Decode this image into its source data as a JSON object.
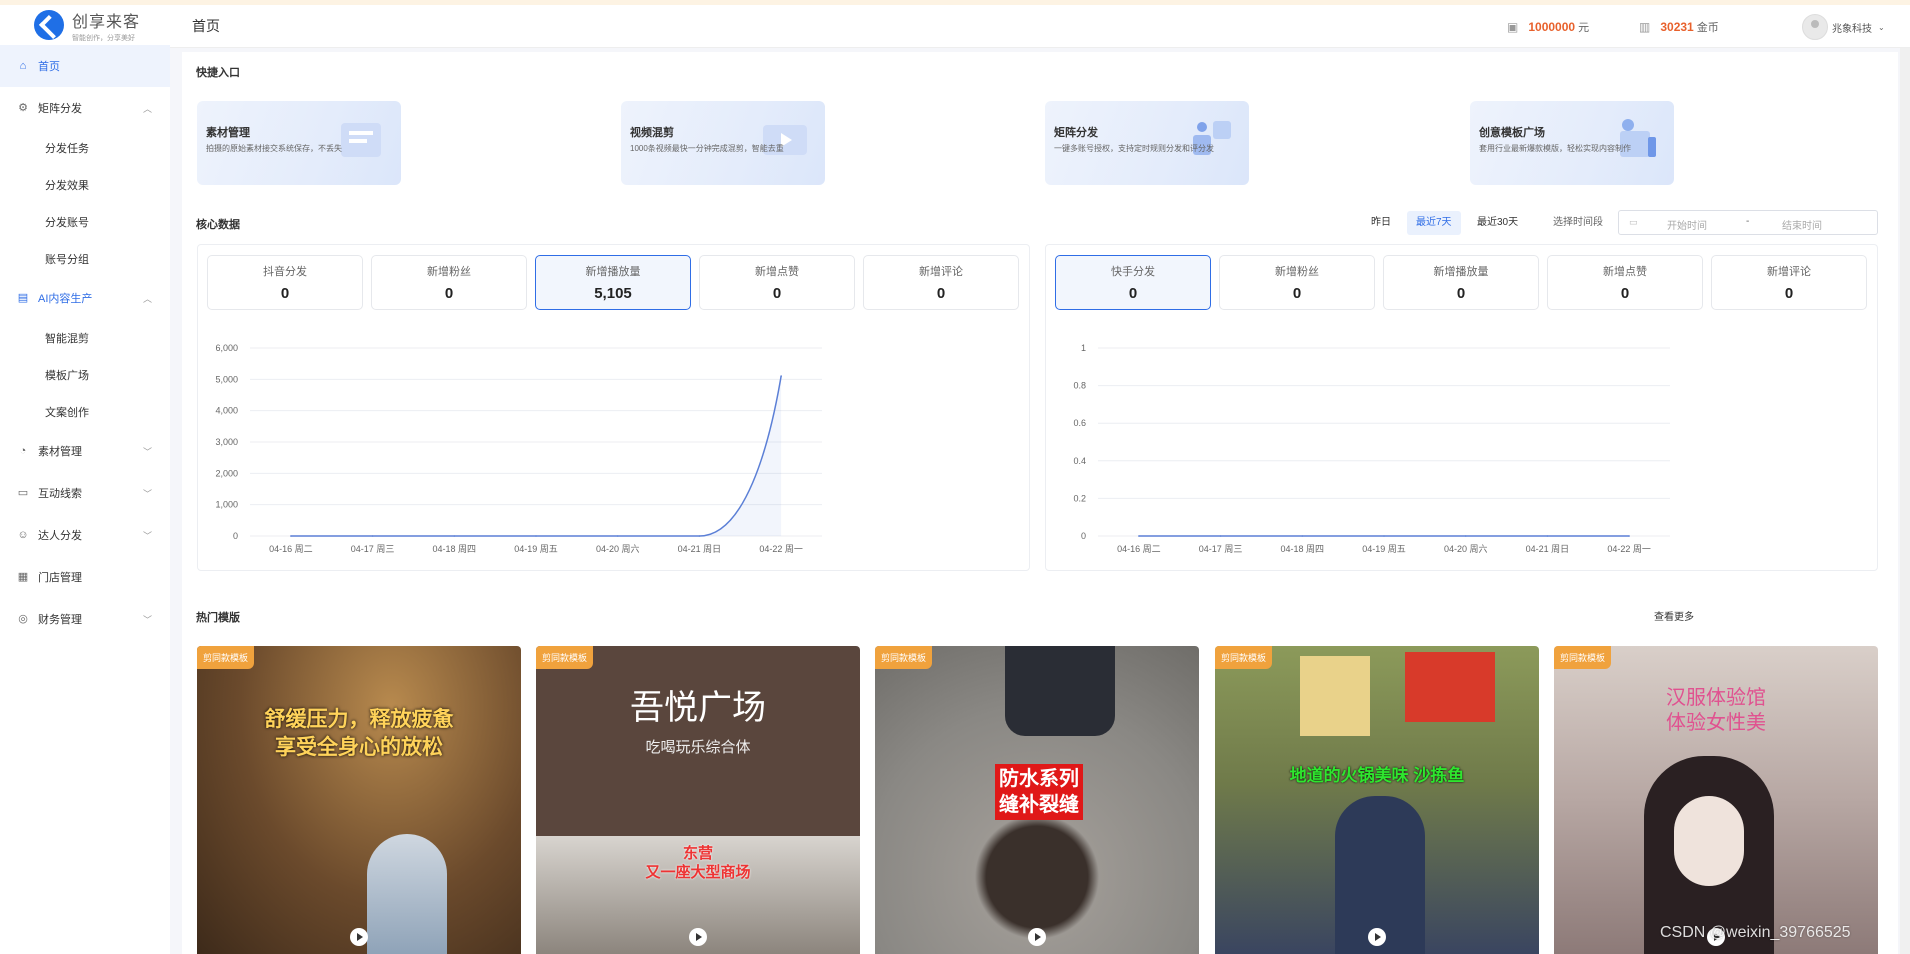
{
  "brand": {
    "name": "创享来客",
    "slogan": "智能创作，分享美好"
  },
  "header": {
    "title": "首页",
    "balance_value": "1000000",
    "balance_unit": "元",
    "coins_value": "30231",
    "coins_unit": "金币",
    "user_name": "兆象科技",
    "dropdown_glyph": "⌄"
  },
  "sidebar": {
    "home": "首页",
    "matrix": {
      "label": "矩阵分发",
      "items": [
        "分发任务",
        "分发效果",
        "分发账号",
        "账号分组"
      ]
    },
    "ai": {
      "label": "AI内容生产",
      "items": [
        "智能混剪",
        "模板广场",
        "文案创作"
      ]
    },
    "material": "素材管理",
    "interaction": "互动线索",
    "talent": "达人分发",
    "store": "门店管理",
    "finance": "财务管理"
  },
  "quick": {
    "title": "快捷入口",
    "cards": [
      {
        "title": "素材管理",
        "desc": "拍摄的原始素材接交系统保存，不丢失"
      },
      {
        "title": "视频混剪",
        "desc": "1000条视频最快一分钟完成混剪，智能去重"
      },
      {
        "title": "矩阵分发",
        "desc": "一键多账号授权，支持定时规则分发和评分发"
      },
      {
        "title": "创意模板广场",
        "desc": "套用行业最新爆款模版，轻松实现内容制作"
      }
    ]
  },
  "core": {
    "title": "核心数据",
    "ranges": [
      "昨日",
      "最近7天",
      "最近30天"
    ],
    "range_label": "选择时间段",
    "date_start_placeholder": "开始时间",
    "date_sep": "-",
    "date_end_placeholder": "结束时间",
    "left_stats": [
      {
        "label": "抖音分发",
        "value": "0"
      },
      {
        "label": "新增粉丝",
        "value": "0"
      },
      {
        "label": "新增播放量",
        "value": "5,105"
      },
      {
        "label": "新增点赞",
        "value": "0"
      },
      {
        "label": "新增评论",
        "value": "0"
      }
    ],
    "right_stats": [
      {
        "label": "快手分发",
        "value": "0"
      },
      {
        "label": "新增粉丝",
        "value": "0"
      },
      {
        "label": "新增播放量",
        "value": "0"
      },
      {
        "label": "新增点赞",
        "value": "0"
      },
      {
        "label": "新增评论",
        "value": "0"
      }
    ]
  },
  "chart_data": [
    {
      "type": "line",
      "x": [
        "04-16 周二",
        "04-17 周三",
        "04-18 周四",
        "04-19 周五",
        "04-20 周六",
        "04-21 周日",
        "04-22 周一"
      ],
      "series": [
        {
          "values": [
            0,
            0,
            0,
            0,
            0,
            0,
            5105
          ]
        }
      ],
      "ylim": [
        0,
        6000
      ],
      "yticks": [
        "0",
        "1,000",
        "2,000",
        "3,000",
        "4,000",
        "5,000",
        "6,000"
      ],
      "grid": true,
      "color": "#5b7fd6"
    },
    {
      "type": "line",
      "x": [
        "04-16 周二",
        "04-17 周三",
        "04-18 周四",
        "04-19 周五",
        "04-20 周六",
        "04-21 周日",
        "04-22 周一"
      ],
      "series": [
        {
          "values": [
            0,
            0,
            0,
            0,
            0,
            0,
            0
          ]
        }
      ],
      "ylim": [
        0,
        1
      ],
      "yticks": [
        "0",
        "0.2",
        "0.4",
        "0.6",
        "0.8",
        "1"
      ],
      "grid": true,
      "color": "#5b7fd6"
    }
  ],
  "hot": {
    "title": "热门模版",
    "more": "查看更多",
    "tag": "剪同款模板",
    "cards": [
      {
        "overlay": "舒缓压力，释放疲惫\n享受全身心的放松",
        "bg": "#6b4a2c"
      },
      {
        "overlay": "吾悦广场",
        "sub": "吃喝玩乐综合体",
        "lower": "东营\n又一座大型商场",
        "bg": "#5a463d"
      },
      {
        "overlay": "防水系列\n缝补裂缝",
        "bg": "#8a8884"
      },
      {
        "overlay": "地道的火锅美味 沙拣鱼",
        "bg": "#6f7a4a"
      },
      {
        "overlay": "汉服体验馆\n体验女性美",
        "bg": "#b7a7a3"
      }
    ]
  },
  "watermark": "CSDN @weixin_39766525"
}
